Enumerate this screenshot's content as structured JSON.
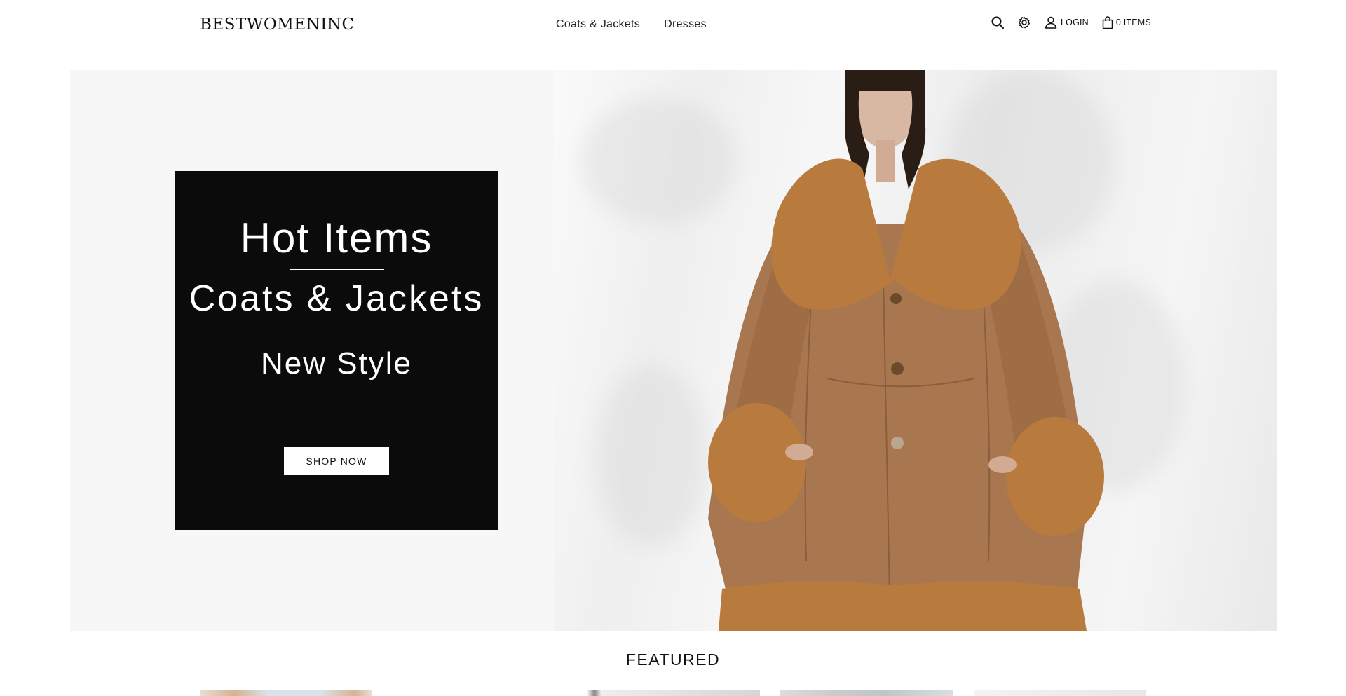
{
  "header": {
    "logo": "BESTWOMENINC",
    "nav": [
      "Coats & Jackets",
      "Dresses"
    ],
    "login_label": "LOGIN",
    "cart_label": "0 ITEMS"
  },
  "hero": {
    "title": "Hot Items",
    "subtitle": "Coats & Jackets",
    "tagline": "New Style",
    "cta": "SHOP NOW"
  },
  "featured": {
    "heading": "FEATURED"
  },
  "icons": {
    "search": "search-icon",
    "settings": "gear-icon",
    "user": "user-icon",
    "cart": "shopping-bag-icon"
  },
  "colors": {
    "panel": "#0b0b0b",
    "coat": "#a9774f",
    "fur": "#b97a3e",
    "text": "#111111"
  }
}
